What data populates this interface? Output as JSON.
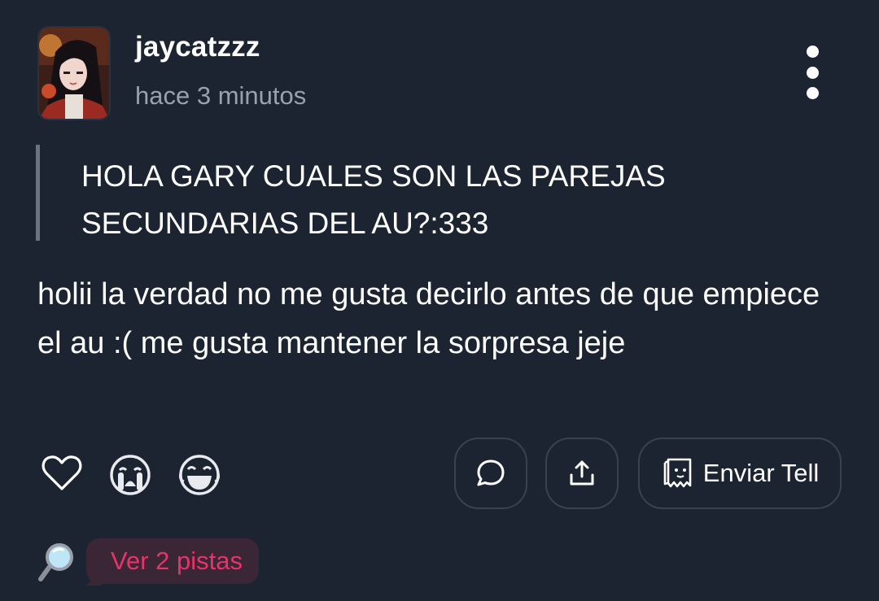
{
  "post": {
    "username": "jaycatzzz",
    "timestamp": "hace 3 minutos",
    "question": "HOLA GARY CUALES SON LAS PAREJAS SECUNDARIAS DEL AU?:333",
    "answer": "holii la verdad no me gusta decirlo antes de que empiece el au :( me gusta mantener la sorpresa jeje"
  },
  "icons": {
    "menu": "more-vertical-icon",
    "like": "heart-icon",
    "cry": "crying-face-icon",
    "laugh": "laughing-face-icon",
    "comment": "comment-bubble-icon",
    "share": "share-upload-icon",
    "tell": "tell-ghost-icon",
    "hint": "magnifier-icon"
  },
  "actions": {
    "send_tell_label": "Enviar Tell",
    "hints_label": "Ver 2 pistas"
  },
  "colors": {
    "background": "#1c2331",
    "hint_text": "#e8336a",
    "hint_bg": "#3a2635",
    "muted": "#9aa1ad"
  }
}
